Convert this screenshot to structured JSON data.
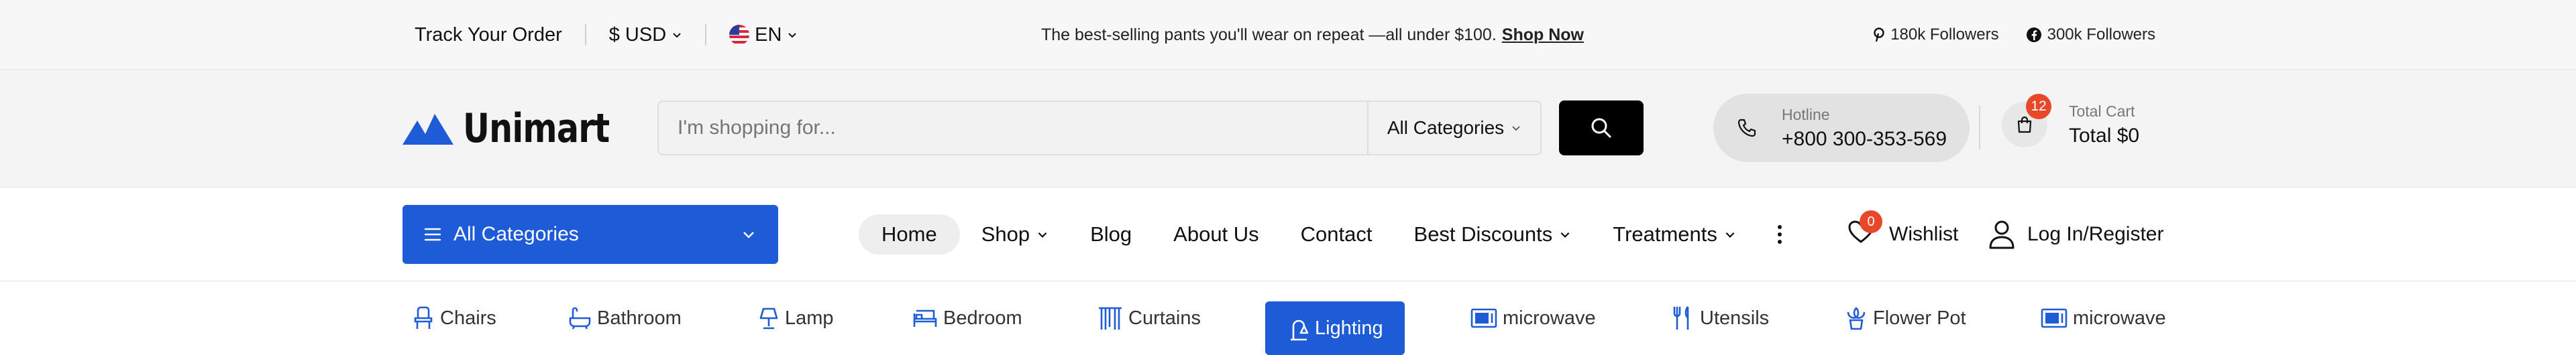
{
  "topbar": {
    "track_order": "Track Your Order",
    "currency": "$ USD",
    "language": "EN",
    "promo_text": "The best-selling pants you'll wear on repeat —all under $100.",
    "promo_link": "Shop Now",
    "pinterest_followers": "180k Followers",
    "facebook_followers": "300k Followers"
  },
  "header": {
    "logo_text": "Unimart",
    "search_placeholder": "I'm shopping for...",
    "category_select": "All Categories",
    "hotline_label": "Hotline",
    "hotline_number": "+800 300-353-569",
    "cart_badge": "12",
    "cart_label": "Total Cart",
    "cart_total": "Total $0"
  },
  "nav": {
    "all_categories": "All Categories",
    "items": [
      {
        "label": "Home"
      },
      {
        "label": "Shop"
      },
      {
        "label": "Blog"
      },
      {
        "label": "About Us"
      },
      {
        "label": "Contact"
      },
      {
        "label": "Best Discounts"
      },
      {
        "label": "Treatments"
      }
    ],
    "wishlist_count": "0",
    "wishlist_label": "Wishlist",
    "login_label": "Log In/Register"
  },
  "categories": [
    {
      "label": "Chairs",
      "icon": "chair-icon"
    },
    {
      "label": "Bathroom",
      "icon": "bathtub-icon"
    },
    {
      "label": "Lamp",
      "icon": "lamp-icon"
    },
    {
      "label": "Bedroom",
      "icon": "bed-icon"
    },
    {
      "label": "Curtains",
      "icon": "curtains-icon"
    },
    {
      "label": "Lighting",
      "icon": "lighting-icon"
    },
    {
      "label": "microwave",
      "icon": "microwave-icon"
    },
    {
      "label": "Utensils",
      "icon": "utensils-icon"
    },
    {
      "label": "Flower Pot",
      "icon": "flower-pot-icon"
    },
    {
      "label": "microwave",
      "icon": "microwave-icon"
    }
  ],
  "colors": {
    "accent": "#1e5bd6",
    "badge": "#e8482a",
    "search_button": "#000000"
  }
}
